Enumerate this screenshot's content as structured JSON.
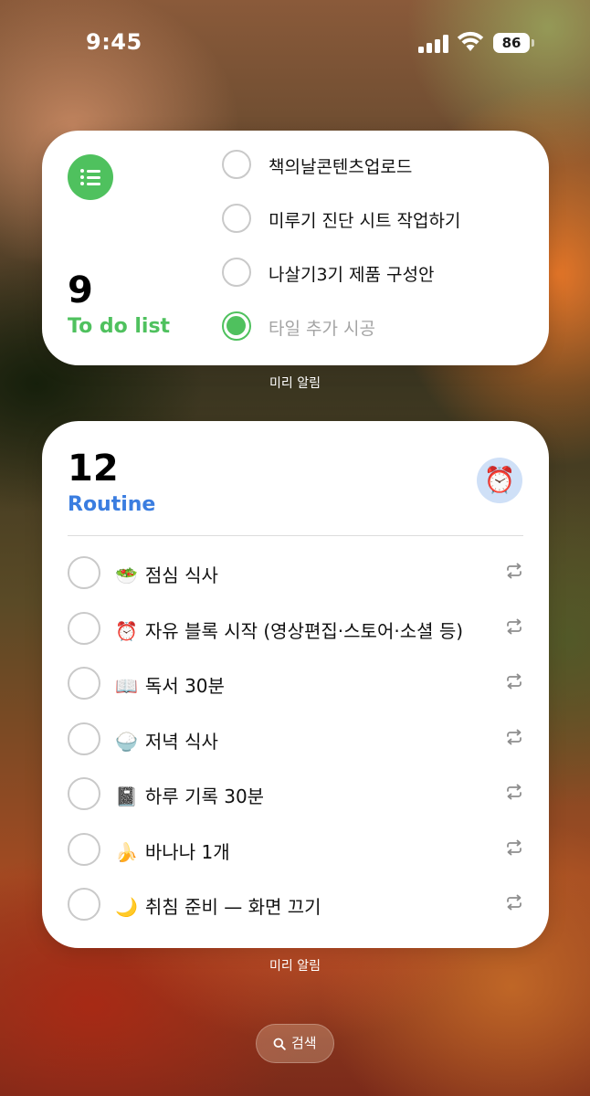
{
  "status_bar": {
    "time": "9:45",
    "battery": "86"
  },
  "todo_widget": {
    "count": "9",
    "title": "To do list",
    "accent": "#4fc15e",
    "items": [
      {
        "text": "책의날콘텐츠업로드",
        "done": false
      },
      {
        "text": "미루기 진단 시트 작업하기",
        "done": false
      },
      {
        "text": "나살기3기 제품 구성안",
        "done": false
      },
      {
        "text": "타일 추가 시공",
        "done": true
      }
    ],
    "caption": "미리 알림"
  },
  "routine_widget": {
    "count": "12",
    "title": "Routine",
    "accent": "#3a7de0",
    "badge_icon": "⏰",
    "items": [
      {
        "emoji": "🥗",
        "text": "점심 식사"
      },
      {
        "emoji": "⏰",
        "text": "자유 블록 시작 (영상편집·스토어·소셜 등)"
      },
      {
        "emoji": "📖",
        "text": "독서 30분"
      },
      {
        "emoji": "🍚",
        "text": "저녁 식사"
      },
      {
        "emoji": "📓",
        "text": "하루 기록 30분"
      },
      {
        "emoji": "🍌",
        "text": "바나나 1개"
      },
      {
        "emoji": "🌙",
        "text": "취침 준비 — 화면 끄기"
      }
    ],
    "caption": "미리 알림"
  },
  "search": {
    "label": "검색"
  }
}
